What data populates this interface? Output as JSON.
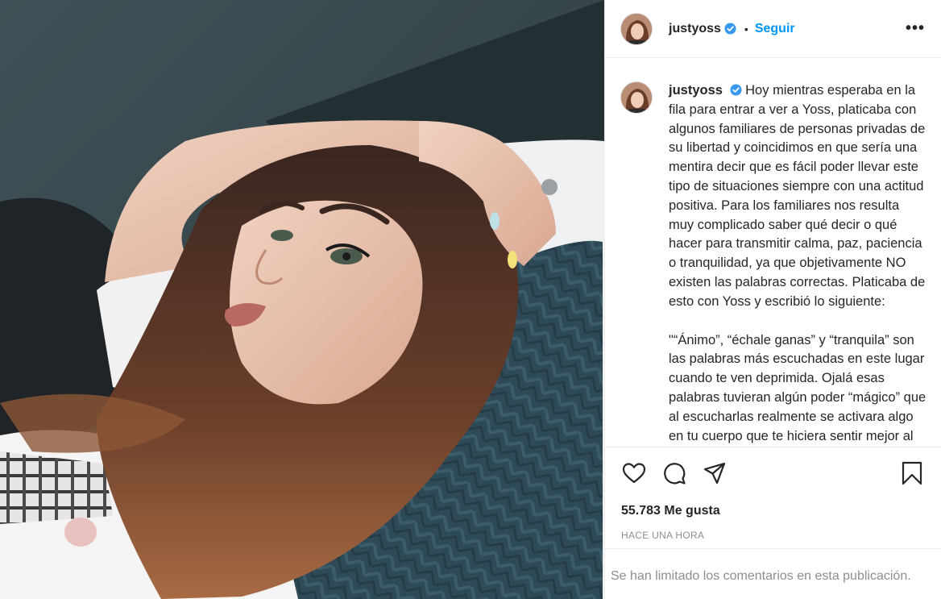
{
  "post": {
    "username": "justyoss",
    "separator": "•",
    "follow_label": "Seguir",
    "more_label": "•••",
    "caption_para1": "Hoy mientras esperaba en la fila para entrar a ver a Yoss, platicaba con algunos familiares de personas privadas de su libertad y coincidimos en que sería una mentira decir que es fácil poder llevar este tipo de situaciones siempre con una actitud positiva. Para los familiares nos resulta muy complicado saber qué decir o qué hacer para transmitir calma, paz, paciencia o tranquilidad, ya que objetivamente NO existen las palabras correctas. Platicaba de esto con Yoss y escribió lo siguiente:",
    "caption_para2": "\"“Ánimo”, “échale ganas” y “tranquila” son las palabras más escuchadas en este lugar cuando te ven deprimida. Ojalá esas palabras tuvieran algún poder “mágico” que al escucharlas realmente se activara algo en tu cuerpo que te hiciera sentir mejor al instante.",
    "likes": "55.783 Me gusta",
    "timestamp": "HACE UNA HORA",
    "comments_limited": "Se han limitado los comentarios en esta publicación."
  },
  "icons": {
    "like": "heart-icon",
    "comment": "comment-icon",
    "share": "paper-plane-icon",
    "save": "bookmark-icon",
    "verified": "verified-badge-icon"
  },
  "colors": {
    "link_blue": "#0095f6",
    "verified_blue": "#3897f0",
    "muted": "#8e8e8e",
    "text": "#262626"
  }
}
